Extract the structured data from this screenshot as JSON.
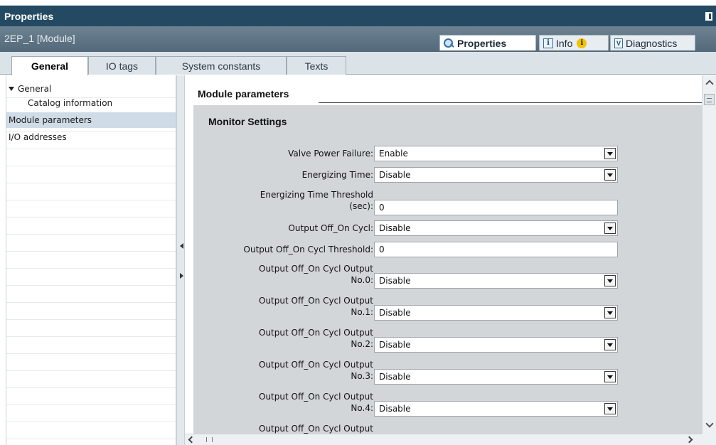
{
  "window": {
    "title": "Properties"
  },
  "object_bar": {
    "name": "2EP_1 [Module]",
    "tabs": [
      {
        "label": "Properties",
        "icon": "properties-magnifier-icon",
        "active": true
      },
      {
        "label": "Info",
        "icon": "info-icon",
        "active": false,
        "badge_icon": "warning-icon"
      },
      {
        "label": "Diagnostics",
        "icon": "diagnostics-icon",
        "active": false
      }
    ]
  },
  "general_tabs": [
    {
      "label": "General",
      "active": true
    },
    {
      "label": "IO tags",
      "active": false
    },
    {
      "label": "System constants",
      "active": false
    },
    {
      "label": "Texts",
      "active": false
    }
  ],
  "nav_tree": [
    {
      "label": "General",
      "expanded": true,
      "selected": false,
      "indent": 0
    },
    {
      "label": "Catalog information",
      "selected": false,
      "indent": 1
    },
    {
      "label": "Module parameters",
      "selected": true,
      "indent": 0
    },
    {
      "label": "I/O addresses",
      "selected": false,
      "indent": 0
    }
  ],
  "content": {
    "section_title": "Module parameters",
    "group_title": "Monitor Settings",
    "fields": [
      {
        "label": "Valve Power Failure:",
        "type": "dropdown",
        "value": "Enable"
      },
      {
        "label": "Energizing Time:",
        "type": "dropdown",
        "value": "Disable"
      },
      {
        "label_lines": [
          "Energizing Time Threshold",
          "(sec):"
        ],
        "type": "text",
        "value": "0"
      },
      {
        "label": "Output Off_On Cycl:",
        "type": "dropdown",
        "value": "Disable"
      },
      {
        "label": "Output Off_On Cycl Threshold:",
        "type": "text",
        "value": "0"
      },
      {
        "label_lines": [
          "Output Off_On Cycl Output",
          "No.0:"
        ],
        "type": "dropdown",
        "value": "Disable"
      },
      {
        "label_lines": [
          "Output Off_On Cycl Output",
          "No.1:"
        ],
        "type": "dropdown",
        "value": "Disable"
      },
      {
        "label_lines": [
          "Output Off_On Cycl Output",
          "No.2:"
        ],
        "type": "dropdown",
        "value": "Disable"
      },
      {
        "label_lines": [
          "Output Off_On Cycl Output",
          "No.3:"
        ],
        "type": "dropdown",
        "value": "Disable"
      },
      {
        "label_lines": [
          "Output Off_On Cycl Output",
          "No.4:"
        ],
        "type": "dropdown",
        "value": "Disable"
      },
      {
        "label_lines": [
          "Output Off_On Cycl Output"
        ],
        "type": "partial",
        "value": ""
      }
    ]
  },
  "colors": {
    "title_bar": "#244a63",
    "object_bar": "#5f7585",
    "selection": "#cfdbe6",
    "settings_background": "#d2d6d9"
  }
}
